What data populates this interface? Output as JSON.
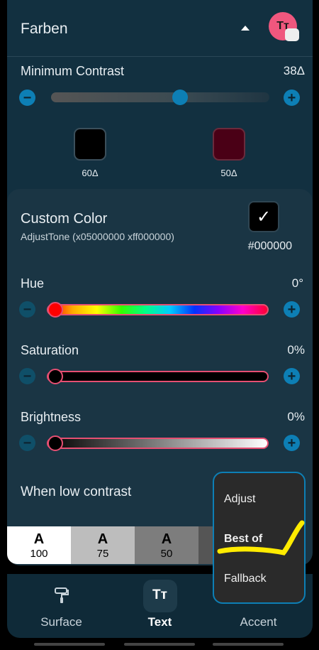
{
  "header": {
    "title": "Farben",
    "avatar_text": "Tт"
  },
  "min_contrast": {
    "label": "Minimum Contrast",
    "value": "38Δ",
    "level": 0.6
  },
  "swatches": [
    {
      "caption": "60Δ",
      "color": "#000000"
    },
    {
      "caption": "50Δ",
      "color": "#4a0016"
    }
  ],
  "custom_color": {
    "title": "Custom Color",
    "subtitle": "AdjustTone (x05000000 xff000000)",
    "hex": "#000000"
  },
  "hue": {
    "label": "Hue",
    "value": "0°"
  },
  "saturation": {
    "label": "Saturation",
    "value": "0%"
  },
  "brightness": {
    "label": "Brightness",
    "value": "0%"
  },
  "low_contrast": {
    "label": "When low contrast"
  },
  "toggles": [
    {
      "a": "A",
      "n": "100"
    },
    {
      "a": "A",
      "n": "75"
    },
    {
      "a": "A",
      "n": "50"
    }
  ],
  "popup": {
    "items": [
      "Adjust",
      "Best of",
      "Fallback"
    ]
  },
  "nav": [
    {
      "label": "Surface",
      "icon": "paint-roller-icon"
    },
    {
      "label": "Text",
      "icon": "text-format-icon"
    },
    {
      "label": "Accent",
      "icon": "accent-icon"
    }
  ],
  "colors": {
    "accent": "#0d7fb5",
    "slider_border": "#e64f72",
    "highlight": "#ffeb00"
  }
}
